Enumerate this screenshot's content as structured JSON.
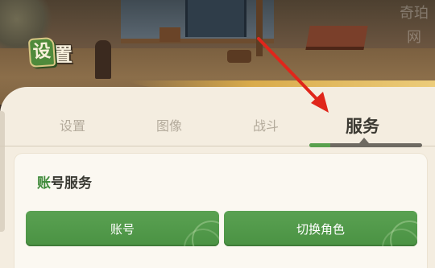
{
  "header": {
    "title_first_char": "设",
    "title_rest": "置"
  },
  "tabs": [
    {
      "label": "设置",
      "active": false
    },
    {
      "label": "图像",
      "active": false
    },
    {
      "label": "战斗",
      "active": false
    },
    {
      "label": "服务",
      "active": true
    }
  ],
  "section": {
    "title_accent": "账",
    "title_rest": "号服务"
  },
  "buttons": {
    "account": "账号",
    "switch_role": "切换角色"
  },
  "watermark": "奇珀网",
  "colors": {
    "accent_green": "#4f9a47",
    "arrow_red": "#e0261b",
    "panel_bg": "#f4ede0"
  }
}
